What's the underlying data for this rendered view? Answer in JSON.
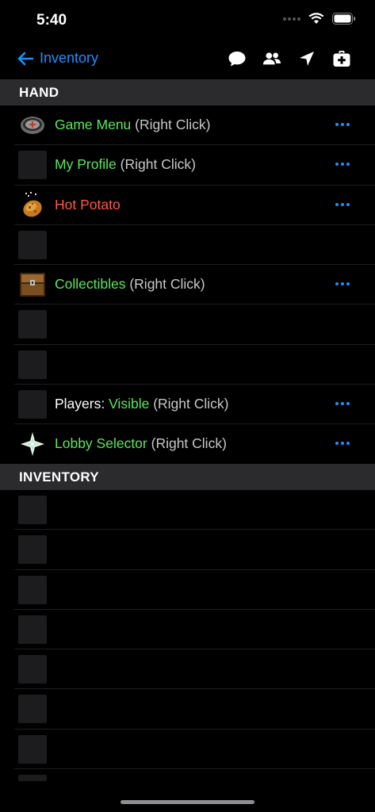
{
  "status": {
    "time": "5:40"
  },
  "nav": {
    "back_label": "Inventory"
  },
  "hand_header": "HAND",
  "inventory_header": "INVENTORY",
  "hand_items": [
    {
      "icon": "game-menu-icon",
      "parts": [
        {
          "text": "Game Menu",
          "color": "green"
        },
        {
          "text": " (Right Click)",
          "color": "gray"
        }
      ],
      "more": true
    },
    {
      "icon": "empty-slot",
      "parts": [
        {
          "text": "My Profile",
          "color": "green"
        },
        {
          "text": " (Right Click)",
          "color": "gray"
        }
      ],
      "more": true
    },
    {
      "icon": "hot-potato-icon",
      "parts": [
        {
          "text": "Hot Potato",
          "color": "red"
        }
      ],
      "more": true
    },
    {
      "icon": "empty-slot",
      "parts": [],
      "more": false
    },
    {
      "icon": "chest-icon",
      "parts": [
        {
          "text": "Collectibles",
          "color": "green"
        },
        {
          "text": " (Right Click)",
          "color": "gray"
        }
      ],
      "more": true
    },
    {
      "icon": "empty-slot",
      "parts": [],
      "more": false
    },
    {
      "icon": "empty-slot",
      "parts": [],
      "more": false
    },
    {
      "icon": "empty-slot",
      "parts": [
        {
          "text": "Players: ",
          "color": "white"
        },
        {
          "text": "Visible",
          "color": "green"
        },
        {
          "text": " (Right Click)",
          "color": "gray"
        }
      ],
      "more": true
    },
    {
      "icon": "nether-star-icon",
      "parts": [
        {
          "text": "Lobby Selector",
          "color": "green"
        },
        {
          "text": " (Right Click)",
          "color": "gray"
        }
      ],
      "more": true
    }
  ],
  "inventory_slots": 8
}
